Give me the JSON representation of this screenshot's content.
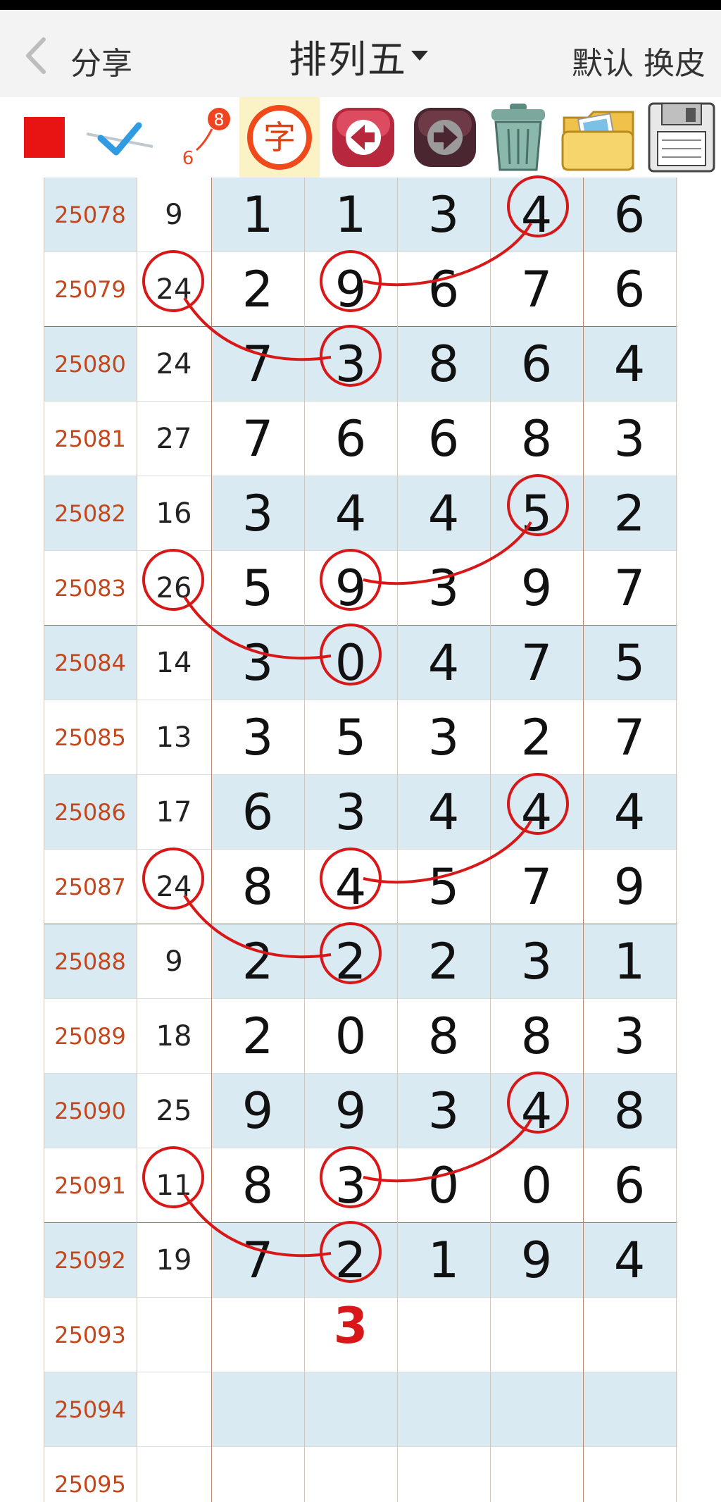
{
  "header": {
    "share_label": "分享",
    "title": "排列五",
    "default_label": "默认",
    "skin_label": "换皮"
  },
  "toolbar": {
    "items": [
      {
        "name": "red-square-tool",
        "icon": "red-square"
      },
      {
        "name": "pen-check-tool",
        "icon": "pen-check"
      },
      {
        "name": "number-connect-tool",
        "icon": "number-connect",
        "top": "8",
        "bottom": "6"
      },
      {
        "name": "text-tool",
        "icon": "char",
        "label": "字"
      },
      {
        "name": "undo-tool",
        "icon": "arrow-left"
      },
      {
        "name": "redo-tool",
        "icon": "arrow-right"
      },
      {
        "name": "trash-tool",
        "icon": "trash-can"
      },
      {
        "name": "photos-tool",
        "icon": "photo-folder"
      },
      {
        "name": "save-tool",
        "icon": "floppy-disk"
      }
    ]
  },
  "colors": {
    "shaded_row": "#d9eaf3",
    "issue_text": "#c5461a",
    "circle": "#d81818",
    "separator": "#b06a40"
  },
  "table": {
    "rows": [
      {
        "issue": "25078",
        "sum": "9",
        "digits": [
          "1",
          "1",
          "3",
          "4",
          "6"
        ]
      },
      {
        "issue": "25079",
        "sum": "24",
        "digits": [
          "2",
          "9",
          "6",
          "7",
          "6"
        ]
      },
      {
        "issue": "25080",
        "sum": "24",
        "digits": [
          "7",
          "3",
          "8",
          "6",
          "4"
        ]
      },
      {
        "issue": "25081",
        "sum": "27",
        "digits": [
          "7",
          "6",
          "6",
          "8",
          "3"
        ]
      },
      {
        "issue": "25082",
        "sum": "16",
        "digits": [
          "3",
          "4",
          "4",
          "5",
          "2"
        ]
      },
      {
        "issue": "25083",
        "sum": "26",
        "digits": [
          "5",
          "9",
          "3",
          "9",
          "7"
        ]
      },
      {
        "issue": "25084",
        "sum": "14",
        "digits": [
          "3",
          "0",
          "4",
          "7",
          "5"
        ]
      },
      {
        "issue": "25085",
        "sum": "13",
        "digits": [
          "3",
          "5",
          "3",
          "2",
          "7"
        ]
      },
      {
        "issue": "25086",
        "sum": "17",
        "digits": [
          "6",
          "3",
          "4",
          "4",
          "4"
        ]
      },
      {
        "issue": "25087",
        "sum": "24",
        "digits": [
          "8",
          "4",
          "5",
          "7",
          "9"
        ]
      },
      {
        "issue": "25088",
        "sum": "9",
        "digits": [
          "2",
          "2",
          "2",
          "3",
          "1"
        ]
      },
      {
        "issue": "25089",
        "sum": "18",
        "digits": [
          "2",
          "0",
          "8",
          "8",
          "3"
        ]
      },
      {
        "issue": "25090",
        "sum": "25",
        "digits": [
          "9",
          "9",
          "3",
          "4",
          "8"
        ]
      },
      {
        "issue": "25091",
        "sum": "11",
        "digits": [
          "8",
          "3",
          "0",
          "0",
          "6"
        ]
      },
      {
        "issue": "25092",
        "sum": "19",
        "digits": [
          "7",
          "2",
          "1",
          "9",
          "4"
        ]
      },
      {
        "issue": "25093",
        "sum": "",
        "digits": [
          "",
          "",
          "",
          "",
          ""
        ]
      },
      {
        "issue": "25094",
        "sum": "",
        "digits": [
          "",
          "",
          "",
          "",
          ""
        ]
      },
      {
        "issue": "25095",
        "sum": "",
        "digits": [
          "",
          "",
          "",
          "",
          ""
        ]
      }
    ],
    "prediction": "3"
  }
}
